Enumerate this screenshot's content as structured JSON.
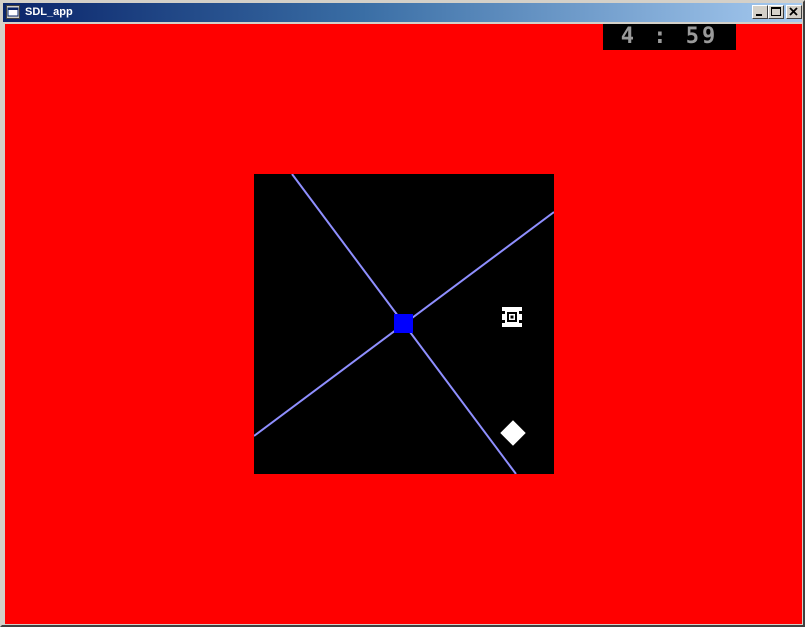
{
  "window": {
    "title": "SDL_app",
    "icon": "app-window-icon",
    "buttons": {
      "minimize": "minimize-icon",
      "maximize": "maximize-icon",
      "close": "close-icon"
    }
  },
  "game": {
    "background_color": "#ff0000",
    "arena_color": "#000000",
    "timer": {
      "minutes": "4",
      "seconds": "59",
      "display": "4 : 59"
    },
    "player": {
      "color": "#0000ff"
    },
    "ray_color": "#8f8fff",
    "target_icon": "target-icon",
    "pickup_icon": "diamond-icon"
  }
}
